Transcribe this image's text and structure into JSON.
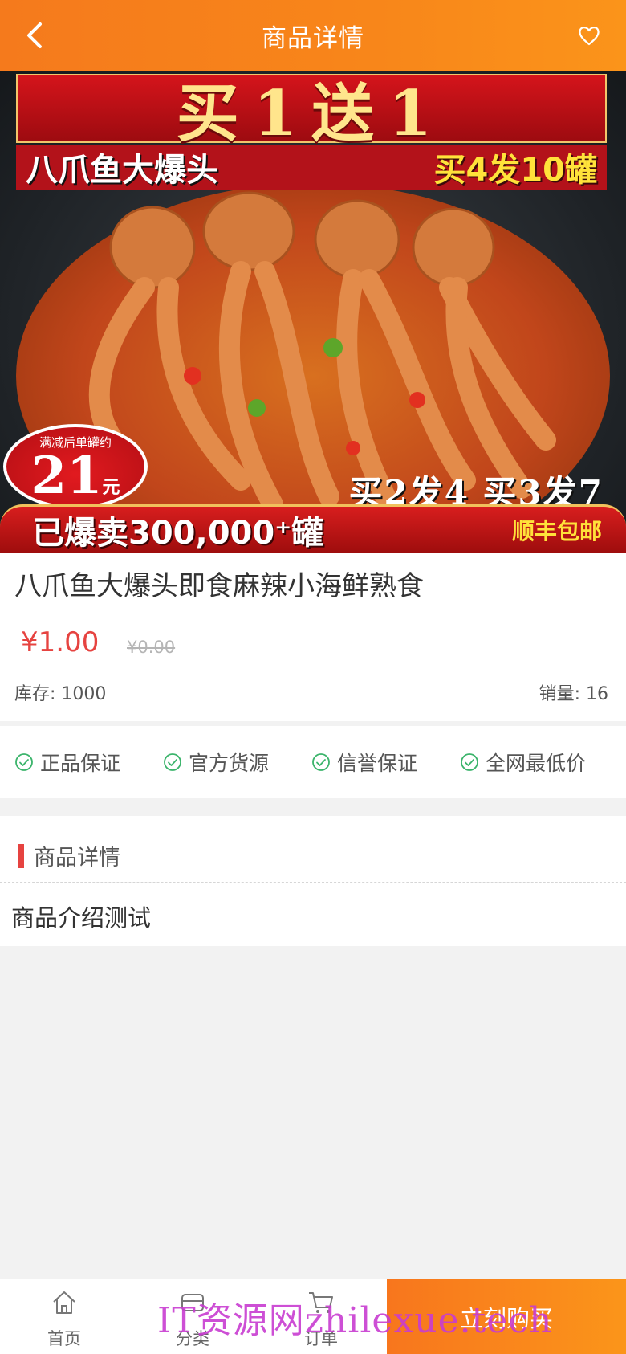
{
  "header": {
    "title": "商品详情",
    "back_icon": "chevron-left",
    "favorite_icon": "heart-outline"
  },
  "banner": {
    "headline": "买1送1",
    "sub_left": "八爪鱼大爆头",
    "sub_right": "买4发10罐",
    "badge_caption": "满减后单罐约",
    "badge_price": "21",
    "badge_unit": "元",
    "offer": "买2发4  买3发7",
    "sold": "已爆卖300,000⁺罐",
    "shipping": "顺丰包邮"
  },
  "product": {
    "title": "八爪鱼大爆头即食麻辣小海鲜熟食",
    "price": "¥1.00",
    "original_price": "¥0.00",
    "stock": "库存: 1000",
    "sales": "销量: 16"
  },
  "guarantees": [
    "正品保证",
    "官方货源",
    "信誉保证",
    "全网最低价"
  ],
  "detail": {
    "heading": "商品详情",
    "content": "商品介绍测试"
  },
  "tabbar": {
    "home": "首页",
    "category": "分类",
    "orders": "订单",
    "buy_now": "立刻购买"
  },
  "watermark": "IT资源网zhilexue.tech",
  "colors": {
    "accent_orange": "#f8861a",
    "price_red": "#e64340",
    "check_green": "#3bb46b"
  }
}
